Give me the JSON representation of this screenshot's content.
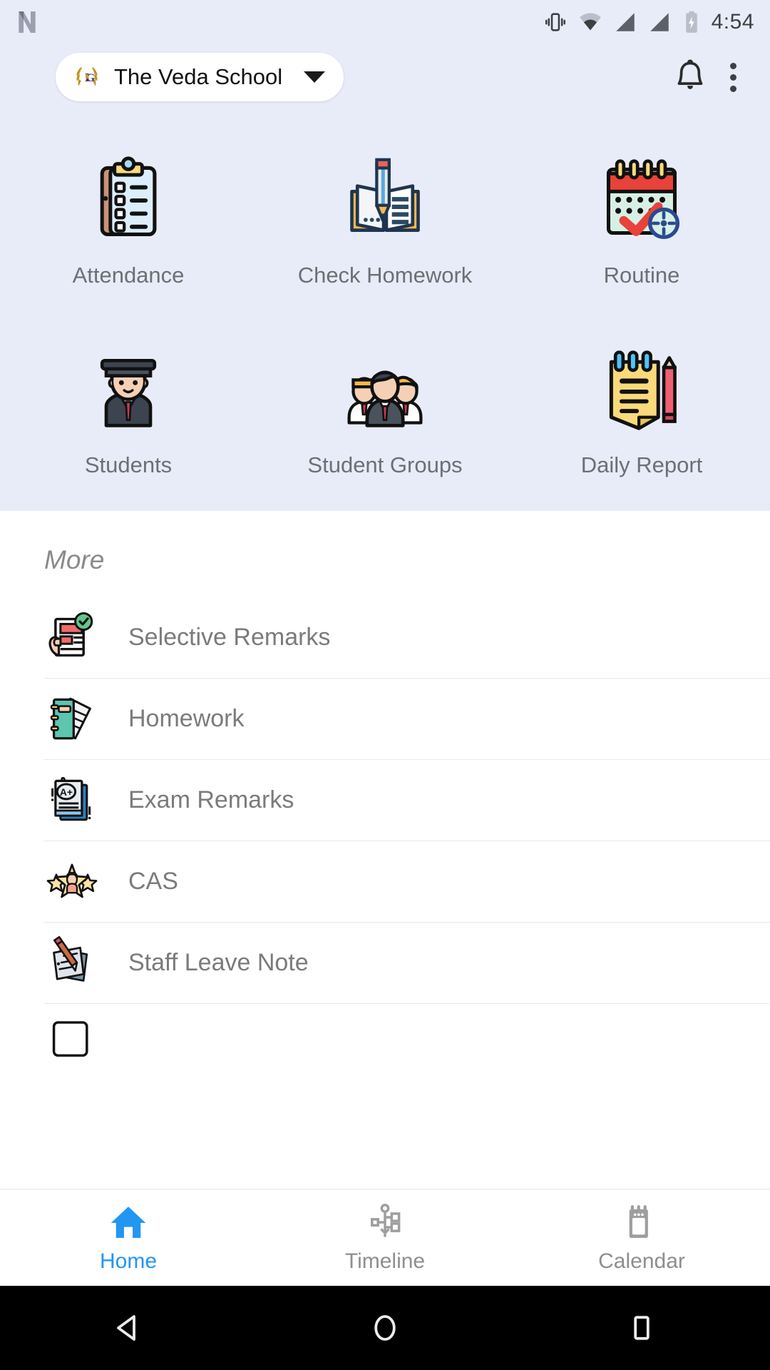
{
  "status_bar": {
    "time": "4:54",
    "icons": [
      "n-logo-icon",
      "vibrate-icon",
      "wifi-icon",
      "signal-1-icon",
      "signal-2-icon",
      "battery-charging-icon"
    ]
  },
  "app_bar": {
    "school_name": "The Veda School",
    "logo_icon": "laurel-wreath-logo",
    "dropdown_icon": "chevron-down-icon",
    "notification_icon": "bell-icon",
    "overflow_icon": "kebab-menu-icon"
  },
  "grid": {
    "items": [
      {
        "label": "Attendance",
        "icon": "clipboard-checklist-icon"
      },
      {
        "label": "Check Homework",
        "icon": "open-book-pencil-icon"
      },
      {
        "label": "Routine",
        "icon": "calendar-check-icon"
      },
      {
        "label": "Students",
        "icon": "graduate-student-icon"
      },
      {
        "label": "Student Groups",
        "icon": "people-group-icon"
      },
      {
        "label": "Daily Report",
        "icon": "notepad-pencil-icon"
      }
    ]
  },
  "more": {
    "title": "More",
    "items": [
      {
        "label": "Selective Remarks",
        "icon": "hand-document-check-icon"
      },
      {
        "label": "Homework",
        "icon": "notebook-papers-icon"
      },
      {
        "label": "Exam Remarks",
        "icon": "grade-paper-aplus-icon"
      },
      {
        "label": "CAS",
        "icon": "three-stars-person-icon"
      },
      {
        "label": "Staff Leave Note",
        "icon": "note-pencil-icon"
      },
      {
        "label": "",
        "icon": "partial-cut-off-icon"
      }
    ]
  },
  "bottom_nav": {
    "items": [
      {
        "label": "Home",
        "icon": "home-icon",
        "active": true
      },
      {
        "label": "Timeline",
        "icon": "timeline-icon",
        "active": false
      },
      {
        "label": "Calendar",
        "icon": "calendar-icon",
        "active": false
      }
    ]
  },
  "system_nav": {
    "back_icon": "triangle-back-icon",
    "home_icon": "circle-home-icon",
    "recents_icon": "square-recents-icon"
  },
  "colors": {
    "panel_bg": "#e8ecf8",
    "accent": "#2196f3",
    "label_gray": "#6d6f74",
    "list_gray": "#7b7b7b"
  }
}
